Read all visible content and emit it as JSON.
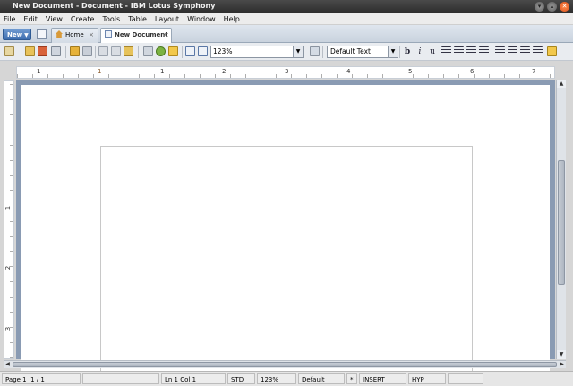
{
  "window": {
    "title": "New Document - Document - IBM Lotus Symphony"
  },
  "window_buttons": [
    "▾",
    "▴",
    "✕"
  ],
  "menu": [
    "File",
    "Edit",
    "View",
    "Create",
    "Tools",
    "Table",
    "Layout",
    "Window",
    "Help"
  ],
  "tabs": {
    "new_label": "New",
    "home_label": "Home",
    "doc_label": "New Document",
    "close_glyph": "×"
  },
  "toolbar": {
    "zoom_value": "123%",
    "style_value": "Default Text",
    "bold": "b",
    "italic": "i",
    "underline": "u"
  },
  "ruler": {
    "h_numbers": [
      "1",
      "1",
      "2",
      "3",
      "4",
      "5",
      "6",
      "7"
    ],
    "v_numbers": [
      "1",
      "2",
      "3"
    ]
  },
  "status": {
    "page": "Page 1",
    "page_count": "1 / 1",
    "position": "Ln 1 Col 1",
    "mode": "STD",
    "zoom": "123%",
    "style": "Default",
    "modified": "*",
    "insert": "INSERT",
    "hyp": "HYP"
  },
  "colors": {
    "accent": "#3e6eaf",
    "doc_background": "#8a9bb3",
    "titlebar": "#2c2c2c"
  }
}
